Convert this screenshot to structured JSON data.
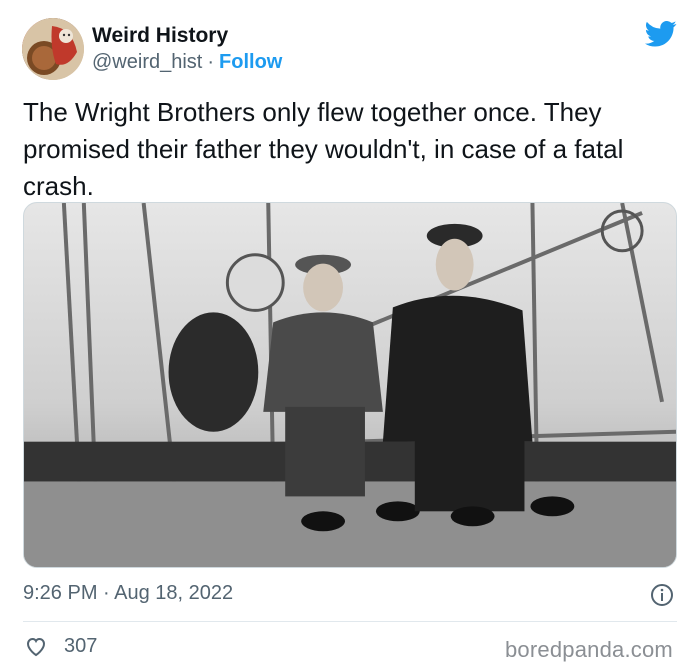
{
  "author": {
    "name": "Weird History",
    "handle": "@weird_hist",
    "separator": "·",
    "follow_label": "Follow"
  },
  "tweet": {
    "text": "The Wright Brothers only flew together once. They promised their father they wouldn't, in case of a fatal crash.",
    "time": "9:26 PM · Aug 18, 2022",
    "likes": "307"
  },
  "watermark": "boredpanda.com",
  "colors": {
    "twitter_blue": "#1d9bf0",
    "secondary_text": "#536471",
    "divider": "#e1e8ed"
  },
  "icons": {
    "brand": "twitter-bird-icon",
    "info": "info-icon",
    "like": "heart-icon"
  }
}
